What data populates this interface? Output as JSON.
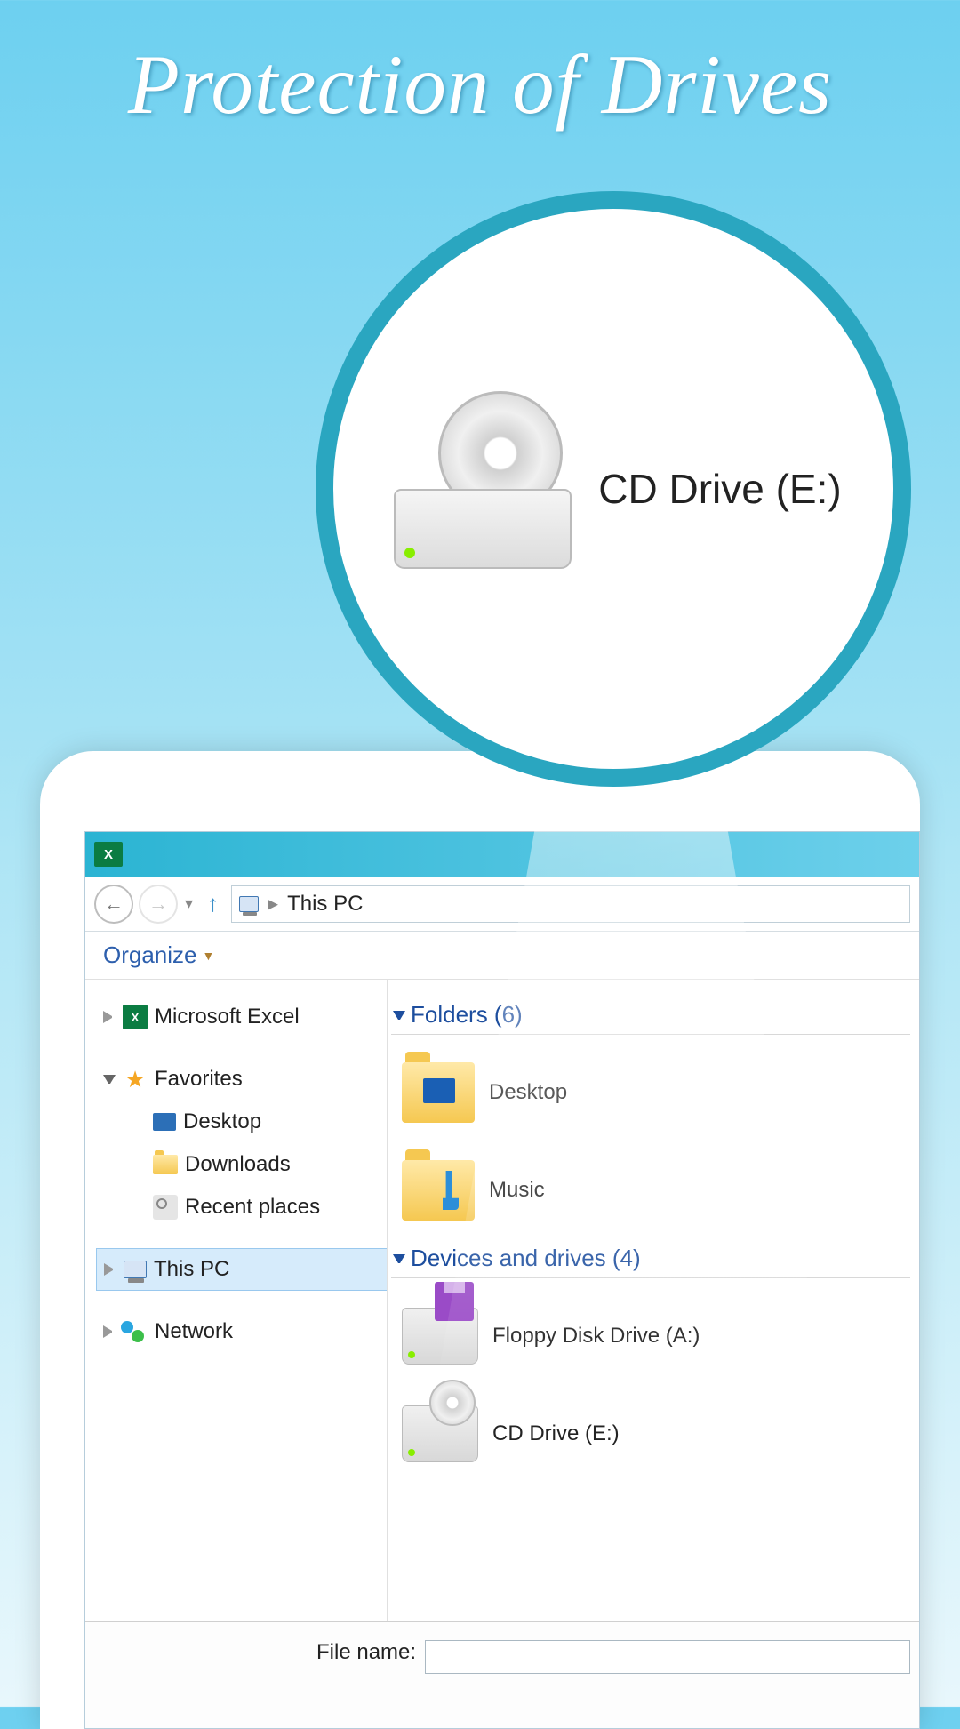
{
  "banner": {
    "title": "Protection of Drives"
  },
  "zoom": {
    "label": "CD Drive (E:)"
  },
  "addressbar": {
    "location": "This PC"
  },
  "toolbar": {
    "organize": "Organize"
  },
  "tree": {
    "excel": "Microsoft Excel",
    "favorites": "Favorites",
    "desktop": "Desktop",
    "downloads": "Downloads",
    "recent": "Recent places",
    "thispc": "This PC",
    "network": "Network"
  },
  "content": {
    "folders_header": "Folders (6)",
    "folder_desktop": "Desktop",
    "folder_music": "Music",
    "drives_header": "Devices and drives (4)",
    "drive_floppy": "Floppy Disk Drive (A:)",
    "drive_cd": "CD Drive (E:)"
  },
  "filename": {
    "label": "File name:",
    "value": ""
  }
}
